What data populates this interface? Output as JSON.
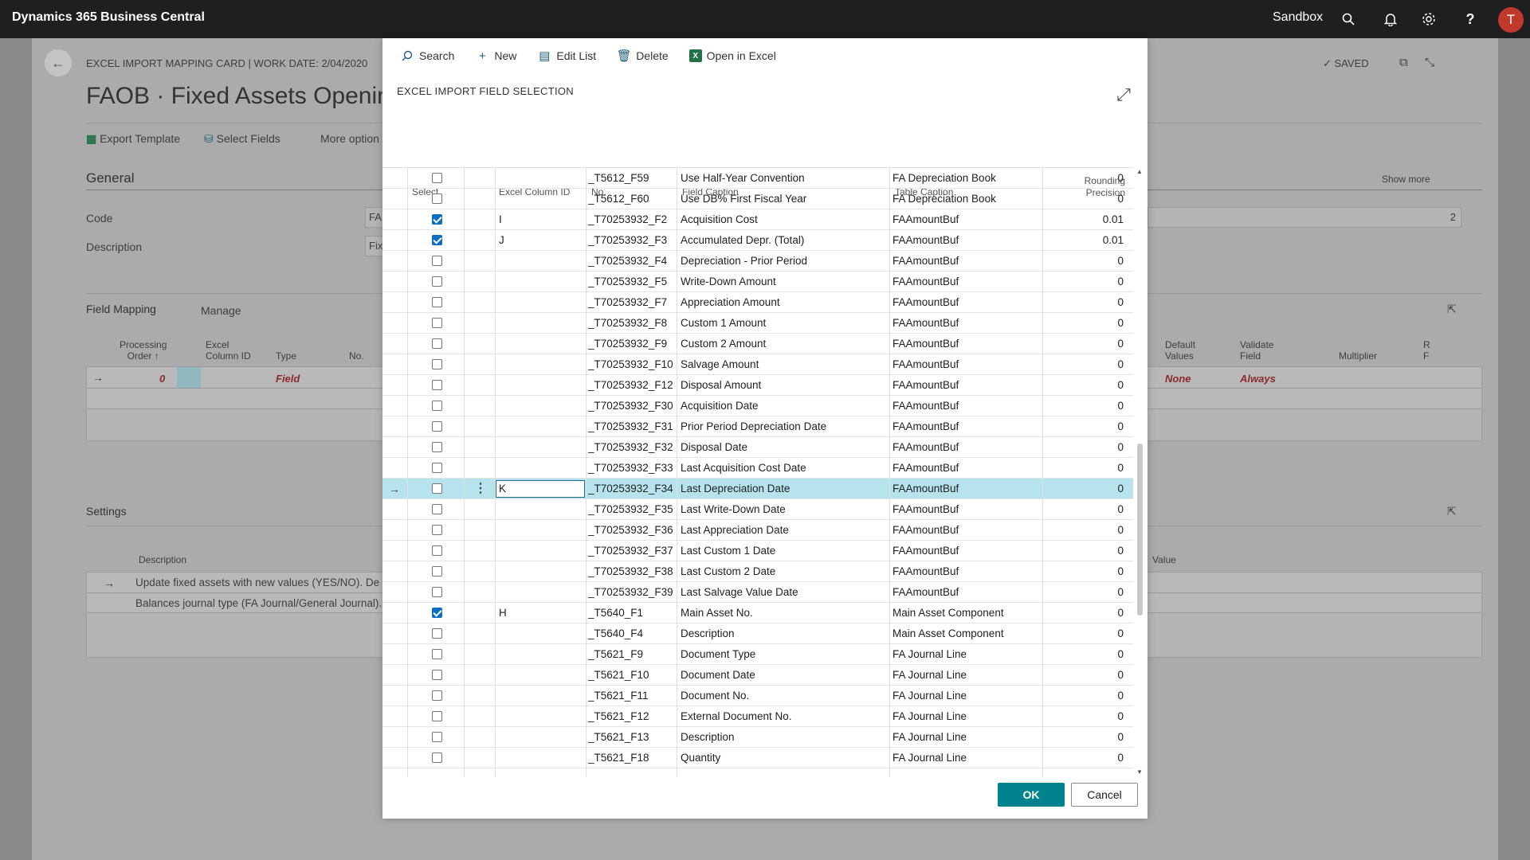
{
  "app": {
    "title": "Dynamics 365 Business Central",
    "environment": "Sandbox",
    "user_initial": "T"
  },
  "background": {
    "caption": "EXCEL IMPORT MAPPING CARD | WORK DATE: 2/04/2020",
    "title": "FAOB · Fixed Assets Opening",
    "saved": "SAVED",
    "actions": {
      "export": "Export Template",
      "select_fields": "Select Fields",
      "more": "More option"
    },
    "general": {
      "heading": "General",
      "show_more": "Show more",
      "code_label": "Code",
      "code_value": "FA",
      "desc_label": "Description",
      "desc_value": "Fix",
      "right_value": "2"
    },
    "field_mapping": {
      "heading": "Field Mapping",
      "manage": "Manage",
      "cols": {
        "processing": "Processing",
        "order": "Order ↑",
        "excel": "Excel",
        "column_id": "Column ID",
        "type": "Type",
        "no": "No.",
        "default": "Default",
        "values": "Values",
        "validate": "Validate",
        "field": "Field",
        "multiplier": "Multiplier",
        "r": "R",
        "f": "F"
      },
      "row": {
        "order": "0",
        "type": "Field",
        "default": "None",
        "validate": "Always"
      }
    },
    "settings": {
      "heading": "Settings",
      "desc_col": "Description",
      "value_col": "Value",
      "rows": [
        "Update fixed assets with new values (YES/NO).  De",
        "Balances journal type (FA Journal/General Journal)."
      ]
    }
  },
  "dialog": {
    "actions": [
      "Search",
      "New",
      "Edit List",
      "Delete",
      "Open in Excel"
    ],
    "title": "EXCEL IMPORT FIELD SELECTION",
    "columns": {
      "select": "Select",
      "excel_col": "Excel Column ID",
      "no": "No.",
      "caption": "Field Caption",
      "table": "Table Caption",
      "rounding1": "Rounding",
      "rounding2": "Precision"
    },
    "rows": [
      {
        "sel": false,
        "col": "",
        "no": "_T5612_F59",
        "caption": "Use Half-Year Convention",
        "table": "FA Depreciation Book",
        "round": "0"
      },
      {
        "sel": false,
        "col": "",
        "no": "_T5612_F60",
        "caption": "Use DB% First Fiscal Year",
        "table": "FA Depreciation Book",
        "round": "0"
      },
      {
        "sel": true,
        "col": "I",
        "no": "_T70253932_F2",
        "caption": "Acquisition Cost",
        "table": "FAAmountBuf",
        "round": "0.01"
      },
      {
        "sel": true,
        "col": "J",
        "no": "_T70253932_F3",
        "caption": "Accumulated Depr. (Total)",
        "table": "FAAmountBuf",
        "round": "0.01"
      },
      {
        "sel": false,
        "col": "",
        "no": "_T70253932_F4",
        "caption": "Depreciation - Prior Period",
        "table": "FAAmountBuf",
        "round": "0"
      },
      {
        "sel": false,
        "col": "",
        "no": "_T70253932_F5",
        "caption": "Write-Down Amount",
        "table": "FAAmountBuf",
        "round": "0"
      },
      {
        "sel": false,
        "col": "",
        "no": "_T70253932_F7",
        "caption": "Appreciation Amount",
        "table": "FAAmountBuf",
        "round": "0"
      },
      {
        "sel": false,
        "col": "",
        "no": "_T70253932_F8",
        "caption": "Custom 1 Amount",
        "table": "FAAmountBuf",
        "round": "0"
      },
      {
        "sel": false,
        "col": "",
        "no": "_T70253932_F9",
        "caption": "Custom 2 Amount",
        "table": "FAAmountBuf",
        "round": "0"
      },
      {
        "sel": false,
        "col": "",
        "no": "_T70253932_F10",
        "caption": "Salvage Amount",
        "table": "FAAmountBuf",
        "round": "0"
      },
      {
        "sel": false,
        "col": "",
        "no": "_T70253932_F12",
        "caption": "Disposal Amount",
        "table": "FAAmountBuf",
        "round": "0"
      },
      {
        "sel": false,
        "col": "",
        "no": "_T70253932_F30",
        "caption": "Acquisition Date",
        "table": "FAAmountBuf",
        "round": "0"
      },
      {
        "sel": false,
        "col": "",
        "no": "_T70253932_F31",
        "caption": "Prior Period Depreciation Date",
        "table": "FAAmountBuf",
        "round": "0"
      },
      {
        "sel": false,
        "col": "",
        "no": "_T70253932_F32",
        "caption": "Disposal Date",
        "table": "FAAmountBuf",
        "round": "0"
      },
      {
        "sel": false,
        "col": "",
        "no": "_T70253932_F33",
        "caption": "Last Acquisition Cost Date",
        "table": "FAAmountBuf",
        "round": "0"
      },
      {
        "sel": false,
        "col": "K",
        "no": "_T70253932_F34",
        "caption": "Last Depreciation Date",
        "table": "FAAmountBuf",
        "round": "0",
        "active": true
      },
      {
        "sel": false,
        "col": "",
        "no": "_T70253932_F35",
        "caption": "Last Write-Down Date",
        "table": "FAAmountBuf",
        "round": "0"
      },
      {
        "sel": false,
        "col": "",
        "no": "_T70253932_F36",
        "caption": "Last Appreciation Date",
        "table": "FAAmountBuf",
        "round": "0"
      },
      {
        "sel": false,
        "col": "",
        "no": "_T70253932_F37",
        "caption": "Last Custom 1 Date",
        "table": "FAAmountBuf",
        "round": "0"
      },
      {
        "sel": false,
        "col": "",
        "no": "_T70253932_F38",
        "caption": "Last Custom 2 Date",
        "table": "FAAmountBuf",
        "round": "0"
      },
      {
        "sel": false,
        "col": "",
        "no": "_T70253932_F39",
        "caption": "Last Salvage Value Date",
        "table": "FAAmountBuf",
        "round": "0"
      },
      {
        "sel": true,
        "col": "H",
        "no": "_T5640_F1",
        "caption": "Main Asset No.",
        "table": "Main Asset Component",
        "round": "0"
      },
      {
        "sel": false,
        "col": "",
        "no": "_T5640_F4",
        "caption": "Description",
        "table": "Main Asset Component",
        "round": "0"
      },
      {
        "sel": false,
        "col": "",
        "no": "_T5621_F9",
        "caption": "Document Type",
        "table": "FA Journal Line",
        "round": "0"
      },
      {
        "sel": false,
        "col": "",
        "no": "_T5621_F10",
        "caption": "Document Date",
        "table": "FA Journal Line",
        "round": "0"
      },
      {
        "sel": false,
        "col": "",
        "no": "_T5621_F11",
        "caption": "Document No.",
        "table": "FA Journal Line",
        "round": "0"
      },
      {
        "sel": false,
        "col": "",
        "no": "_T5621_F12",
        "caption": "External Document No.",
        "table": "FA Journal Line",
        "round": "0"
      },
      {
        "sel": false,
        "col": "",
        "no": "_T5621_F13",
        "caption": "Description",
        "table": "FA Journal Line",
        "round": "0"
      },
      {
        "sel": false,
        "col": "",
        "no": "_T5621_F18",
        "caption": "Quantity",
        "table": "FA Journal Line",
        "round": "0"
      }
    ],
    "ok": "OK",
    "cancel": "Cancel"
  }
}
